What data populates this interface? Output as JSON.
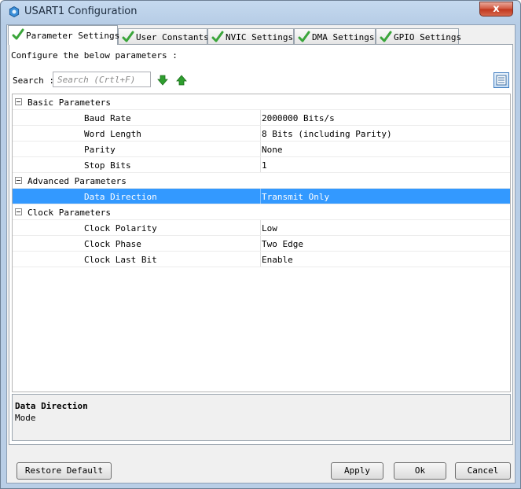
{
  "window": {
    "title": "USART1 Configuration",
    "close_label": "x"
  },
  "tabs": [
    {
      "label": "Parameter Settings"
    },
    {
      "label": "User Constants"
    },
    {
      "label": "NVIC Settings"
    },
    {
      "label": "DMA Settings"
    },
    {
      "label": "GPIO Settings"
    }
  ],
  "panel": {
    "instruction": "Configure the below parameters :",
    "search_label": "Search :",
    "search_placeholder": "Search (Crtl+F)"
  },
  "groups": [
    {
      "name": "Basic Parameters",
      "params": [
        {
          "name": "Baud Rate",
          "value": "2000000 Bits/s"
        },
        {
          "name": "Word Length",
          "value": "8 Bits (including Parity)"
        },
        {
          "name": "Parity",
          "value": "None"
        },
        {
          "name": "Stop Bits",
          "value": "1"
        }
      ]
    },
    {
      "name": "Advanced Parameters",
      "params": [
        {
          "name": "Data Direction",
          "value": "Transmit Only"
        }
      ]
    },
    {
      "name": "Clock Parameters",
      "params": [
        {
          "name": "Clock Polarity",
          "value": "Low"
        },
        {
          "name": "Clock Phase",
          "value": "Two Edge"
        },
        {
          "name": "Clock Last Bit",
          "value": "Enable"
        }
      ]
    }
  ],
  "description": {
    "title": "Data Direction",
    "text": "Mode"
  },
  "buttons": {
    "restore": "Restore Default",
    "apply": "Apply",
    "ok": "Ok",
    "cancel": "Cancel"
  },
  "colors": {
    "selection": "#3399ff",
    "check_green": "#3aa53a",
    "arrow_green": "#2e9e2e"
  }
}
